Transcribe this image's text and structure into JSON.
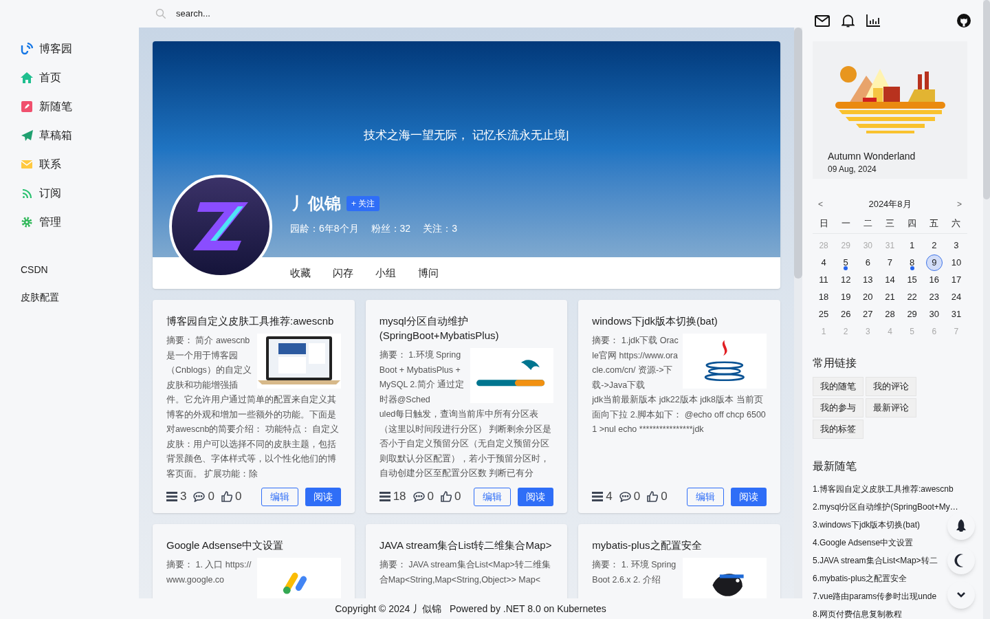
{
  "search": {
    "placeholder": "search..."
  },
  "nav": [
    "博客园",
    "首页",
    "新随笔",
    "草稿箱",
    "联系",
    "订阅",
    "管理"
  ],
  "extra_links": [
    "CSDN",
    "皮肤配置"
  ],
  "profile": {
    "motto": "技术之海一望无际， 记忆长流永无止境|",
    "name": "丿似锦",
    "follow": "+ 关注",
    "stats": [
      "园龄：6年8个月",
      "粉丝：32",
      "关注：3"
    ],
    "tabs": [
      "收藏",
      "闪存",
      "小组",
      "博问"
    ]
  },
  "posts": [
    {
      "title": "博客园自定义皮肤工具推荐:awescnb",
      "summary": [
        "摘要： 简介 awescnb是一个用于博客园（Cnblogs）的自定义皮肤和功能增强插",
        "件。它允许用户通过简单的配置来自定义其博客的外观和增加一些额外的功能。下面是对awescnb的简要介绍： 功能特点： 自定义皮肤：用户可以选择不同的皮肤主题，包括背景颜色、字体样式等，以个性化他们的博客页面。 扩展功能：除"
      ],
      "views": "3",
      "comments": "0",
      "likes": "0",
      "edit": "编辑",
      "read": "阅读"
    },
    {
      "title": "mysql分区自动维护(SpringBoot+MybatisPlus)",
      "summary": [
        "摘要： 1.环境 SpringBoot + MybatisPlus + MySQL 2.简介 通过定时器@Sched",
        "uled每日触发，查询当前库中所有分区表（这里以时间段进行分区） 判断剩余分区是否小于自定义预留分区（无自定义预留分区则取默认分区配置），若小于预留分区时，自动创建分区至配置分区数 判断已有分"
      ],
      "views": "18",
      "comments": "0",
      "likes": "0",
      "edit": "编辑",
      "read": "阅读"
    },
    {
      "title": "windows下jdk版本切换(bat)",
      "summary": [
        "摘要： 1.jdk下载 Oracle官网 https://www.oracle.com/cn/ 资源->下载->Java下载",
        "jdk当前最新版本 jdk22版本 jdk8版本 当前页面向下拉 2.脚本如下： @echo off chcp 65001 >nul echo ****************jdk"
      ],
      "views": "4",
      "comments": "0",
      "likes": "0",
      "edit": "编辑",
      "read": "阅读"
    },
    {
      "title": "Google Adsense中文设置",
      "summary": [
        "摘要： 1. 入口 https://www.google.co"
      ]
    },
    {
      "title": "JAVA stream集合List转二维集合Map>",
      "summary": [
        "摘要： JAVA stream集合List<Map>转二维集合Map<String,Map<String,Object>> Map<"
      ]
    },
    {
      "title": "mybatis-plus之配置安全",
      "summary": [
        "摘要： 1. 环境 SpringBoot 2.6.x 2. 介绍"
      ]
    }
  ],
  "footer": "Copyright © 2024 丿似锦   Powered by .NET 8.0 on Kubernetes",
  "weather": {
    "title": "Autumn Wonderland",
    "date": "09 Aug, 2024"
  },
  "calendar": {
    "prev": "<",
    "month": "2024年8月",
    "next": ">",
    "weekdays": [
      "日",
      "一",
      "二",
      "三",
      "四",
      "五",
      "六"
    ],
    "days": [
      {
        "day": "28",
        "other_month": true,
        "has_post": false,
        "selected": false
      },
      {
        "day": "29",
        "other_month": true,
        "has_post": false,
        "selected": false
      },
      {
        "day": "30",
        "other_month": true,
        "has_post": false,
        "selected": false
      },
      {
        "day": "31",
        "other_month": true,
        "has_post": false,
        "selected": false
      },
      {
        "day": "1",
        "other_month": false,
        "has_post": false,
        "selected": false
      },
      {
        "day": "2",
        "other_month": false,
        "has_post": false,
        "selected": false
      },
      {
        "day": "3",
        "other_month": false,
        "has_post": false,
        "selected": false
      },
      {
        "day": "4",
        "other_month": false,
        "has_post": false,
        "selected": false
      },
      {
        "day": "5",
        "other_month": false,
        "has_post": true,
        "selected": false
      },
      {
        "day": "6",
        "other_month": false,
        "has_post": false,
        "selected": false
      },
      {
        "day": "7",
        "other_month": false,
        "has_post": false,
        "selected": false
      },
      {
        "day": "8",
        "other_month": false,
        "has_post": true,
        "selected": false
      },
      {
        "day": "9",
        "other_month": false,
        "has_post": false,
        "selected": true
      },
      {
        "day": "10",
        "other_month": false,
        "has_post": false,
        "selected": false
      },
      {
        "day": "11",
        "other_month": false,
        "has_post": false,
        "selected": false
      },
      {
        "day": "12",
        "other_month": false,
        "has_post": false,
        "selected": false
      },
      {
        "day": "13",
        "other_month": false,
        "has_post": false,
        "selected": false
      },
      {
        "day": "14",
        "other_month": false,
        "has_post": false,
        "selected": false
      },
      {
        "day": "15",
        "other_month": false,
        "has_post": false,
        "selected": false
      },
      {
        "day": "16",
        "other_month": false,
        "has_post": false,
        "selected": false
      },
      {
        "day": "17",
        "other_month": false,
        "has_post": false,
        "selected": false
      },
      {
        "day": "18",
        "other_month": false,
        "has_post": false,
        "selected": false
      },
      {
        "day": "19",
        "other_month": false,
        "has_post": false,
        "selected": false
      },
      {
        "day": "20",
        "other_month": false,
        "has_post": false,
        "selected": false
      },
      {
        "day": "21",
        "other_month": false,
        "has_post": false,
        "selected": false
      },
      {
        "day": "22",
        "other_month": false,
        "has_post": false,
        "selected": false
      },
      {
        "day": "23",
        "other_month": false,
        "has_post": false,
        "selected": false
      },
      {
        "day": "24",
        "other_month": false,
        "has_post": false,
        "selected": false
      },
      {
        "day": "25",
        "other_month": false,
        "has_post": false,
        "selected": false
      },
      {
        "day": "26",
        "other_month": false,
        "has_post": false,
        "selected": false
      },
      {
        "day": "27",
        "other_month": false,
        "has_post": false,
        "selected": false
      },
      {
        "day": "28",
        "other_month": false,
        "has_post": false,
        "selected": false
      },
      {
        "day": "29",
        "other_month": false,
        "has_post": false,
        "selected": false
      },
      {
        "day": "30",
        "other_month": false,
        "has_post": false,
        "selected": false
      },
      {
        "day": "31",
        "other_month": false,
        "has_post": false,
        "selected": false
      },
      {
        "day": "1",
        "other_month": true,
        "has_post": false,
        "selected": false
      },
      {
        "day": "2",
        "other_month": true,
        "has_post": false,
        "selected": false
      },
      {
        "day": "3",
        "other_month": true,
        "has_post": false,
        "selected": false
      },
      {
        "day": "4",
        "other_month": true,
        "has_post": false,
        "selected": false
      },
      {
        "day": "5",
        "other_month": true,
        "has_post": false,
        "selected": false
      },
      {
        "day": "6",
        "other_month": true,
        "has_post": false,
        "selected": false
      },
      {
        "day": "7",
        "other_month": true,
        "has_post": false,
        "selected": false
      }
    ]
  },
  "links": {
    "title": "常用链接",
    "items": [
      "我的随笔",
      "我的评论",
      "我的参与",
      "最新评论",
      "我的标签"
    ]
  },
  "recent": {
    "title": "最新随笔",
    "items": [
      "1.博客园自定义皮肤工具推荐:awescnb",
      "2.mysql分区自动维护(SpringBoot+My…",
      "3.windows下jdk版本切换(bat)",
      "4.Google Adsense中文设置",
      "5.JAVA stream集合List<Map>转二",
      "6.mybatis-plus之配置安全",
      "7.vue路由params传参时出现unde",
      "8.网页付费信息复制教程"
    ]
  }
}
